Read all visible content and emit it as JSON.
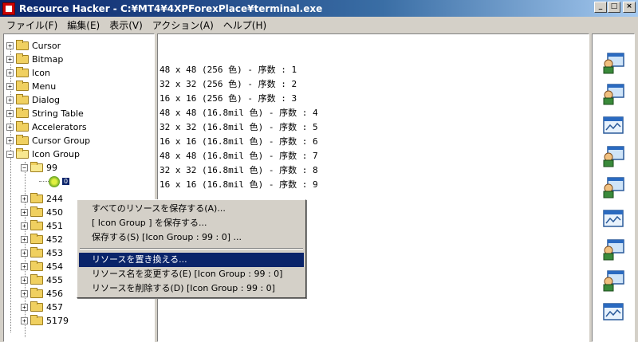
{
  "window": {
    "title": "Resource Hacker  -  C:¥MT4¥4XPForexPlace¥terminal.exe",
    "minimize": "_",
    "maximize": "□",
    "close": "×"
  },
  "menu": [
    "ファイル(F)",
    "編集(E)",
    "表示(V)",
    "アクション(A)",
    "ヘルプ(H)"
  ],
  "tree": {
    "items": [
      {
        "label": "Cursor",
        "exp": "+"
      },
      {
        "label": "Bitmap",
        "exp": "+"
      },
      {
        "label": "Icon",
        "exp": "+"
      },
      {
        "label": "Menu",
        "exp": "+"
      },
      {
        "label": "Dialog",
        "exp": "+"
      },
      {
        "label": "String Table",
        "exp": "+"
      },
      {
        "label": "Accelerators",
        "exp": "+"
      },
      {
        "label": "Cursor Group",
        "exp": "+"
      },
      {
        "label": "Icon Group",
        "exp": "−"
      }
    ],
    "sub_item": {
      "label": "99",
      "exp": "−"
    },
    "leaf": {
      "label": "0"
    },
    "group_children": [
      "244",
      "450",
      "451",
      "452",
      "453",
      "454",
      "455",
      "456",
      "457",
      "5179"
    ]
  },
  "content": {
    "lines": [
      "48 x 48 (256 色) - 序数 : 1",
      "32 x 32 (256 色) - 序数 : 2",
      "16 x 16 (256 色) - 序数 : 3",
      "48 x 48 (16.8mil 色) - 序数 : 4",
      "32 x 32 (16.8mil 色) - 序数 : 5",
      "16 x 16 (16.8mil 色) - 序数 : 6",
      "48 x 48 (16.8mil 色) - 序数 : 7",
      "32 x 32 (16.8mil 色) - 序数 : 8",
      "16 x 16 (16.8mil 色) - 序数 : 9"
    ]
  },
  "context_menu": {
    "save_all": "すべてのリソースを保存する(A)...",
    "save_group": "[ Icon Group ] を保存する...",
    "save_item": "保存する(S) [Icon Group : 99 : 0] ...",
    "replace": "リソースを置き換える...",
    "rename": "リソース名を変更する(E) [Icon Group : 99 : 0]",
    "delete": "リソースを削除する(D) [Icon Group : 99 : 0]"
  },
  "preview_icons": [
    "terminal-person-icon",
    "terminal-person-icon",
    "chart-window-icon",
    "terminal-person-icon",
    "terminal-person-icon",
    "chart-window-icon",
    "terminal-person-icon",
    "terminal-person-icon",
    "chart-window-icon"
  ]
}
